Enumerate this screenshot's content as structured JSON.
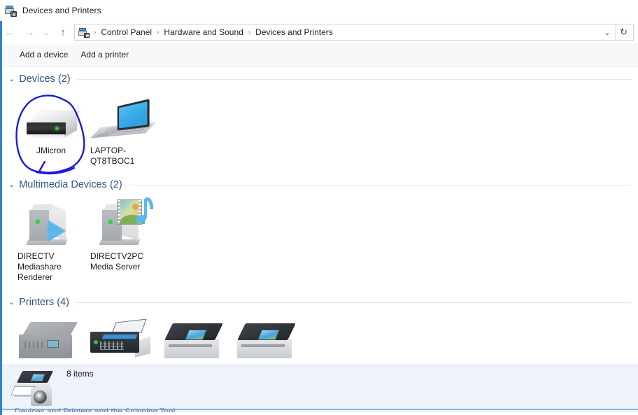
{
  "window": {
    "title": "Devices and Printers",
    "title_icon": "printer-camera-icon"
  },
  "navigation": {
    "back_icon": "arrow-left-icon",
    "forward_icon": "arrow-right-icon",
    "recent_icon": "chevron-down-icon",
    "up_icon": "arrow-up-icon",
    "breadcrumb_icon": "printer-camera-icon",
    "breadcrumbs": [
      {
        "label": "Control Panel"
      },
      {
        "label": "Hardware and Sound"
      },
      {
        "label": "Devices and Printers"
      }
    ],
    "separator": "›",
    "dropdown_icon": "chevron-down-icon",
    "refresh_icon": "refresh-icon"
  },
  "toolbar": {
    "items": [
      {
        "label": "Add a device",
        "name": "add-a-device-button"
      },
      {
        "label": "Add a printer",
        "name": "add-a-printer-button"
      }
    ]
  },
  "groups": [
    {
      "id": "devices",
      "title": "Devices (2)",
      "chevron": "⌄",
      "items": [
        {
          "label": "JMicron",
          "icon": "external-hard-drive-icon",
          "annotated": true
        },
        {
          "label": "LAPTOP-QT8TBOC1",
          "icon": "laptop-icon",
          "annotated": false
        }
      ]
    },
    {
      "id": "multimedia-devices",
      "title": "Multimedia Devices (2)",
      "chevron": "⌄",
      "items": [
        {
          "label": "DIRECTV Mediashare Renderer",
          "icon": "media-renderer-icon",
          "annotated": false
        },
        {
          "label": "DIRECTV2PC Media Server",
          "icon": "media-server-icon",
          "annotated": false
        }
      ]
    },
    {
      "id": "printers",
      "title": "Printers (4)",
      "chevron": "⌄",
      "items": [
        {
          "label": "",
          "icon": "multifunction-printer-grey-icon",
          "annotated": false
        },
        {
          "label": "",
          "icon": "fax-printer-dark-icon",
          "annotated": false
        },
        {
          "label": "",
          "icon": "copier-printer-icon",
          "annotated": false
        },
        {
          "label": "",
          "icon": "copier-printer-icon",
          "annotated": false
        }
      ]
    }
  ],
  "status": {
    "item_count_label": "8 items",
    "floating_icon": "printer-camera-icon",
    "clipped_label": "Devices and Printers and the Snipping Tool"
  },
  "annotation": {
    "type": "freehand-circle-with-arrow",
    "color": "#1b19e0",
    "target": "JMicron"
  }
}
